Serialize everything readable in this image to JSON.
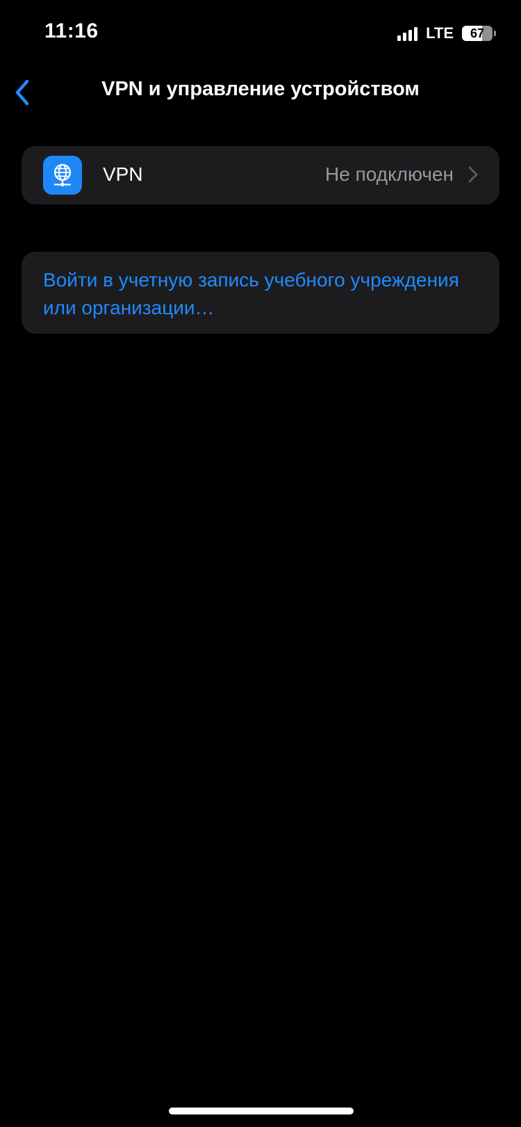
{
  "status_bar": {
    "time": "11:16",
    "network": "LTE",
    "battery_level": "67",
    "battery_fraction": 0.67,
    "signal_bars": 4
  },
  "nav": {
    "title": "VPN и управление устройством",
    "back_icon": "chevron-left-icon"
  },
  "vpn_row": {
    "icon": "globe-network-icon",
    "label": "VPN",
    "status": "Не подключен",
    "chevron_icon": "chevron-right-icon"
  },
  "login_row": {
    "link_text": "Войти в учетную запись учебного учреждения или организации…"
  },
  "colors": {
    "background": "#000000",
    "group_background": "#1c1c1e",
    "accent": "#1f8bff",
    "secondary_text": "#98989e",
    "vpn_icon_bg": "#1e88f7"
  }
}
